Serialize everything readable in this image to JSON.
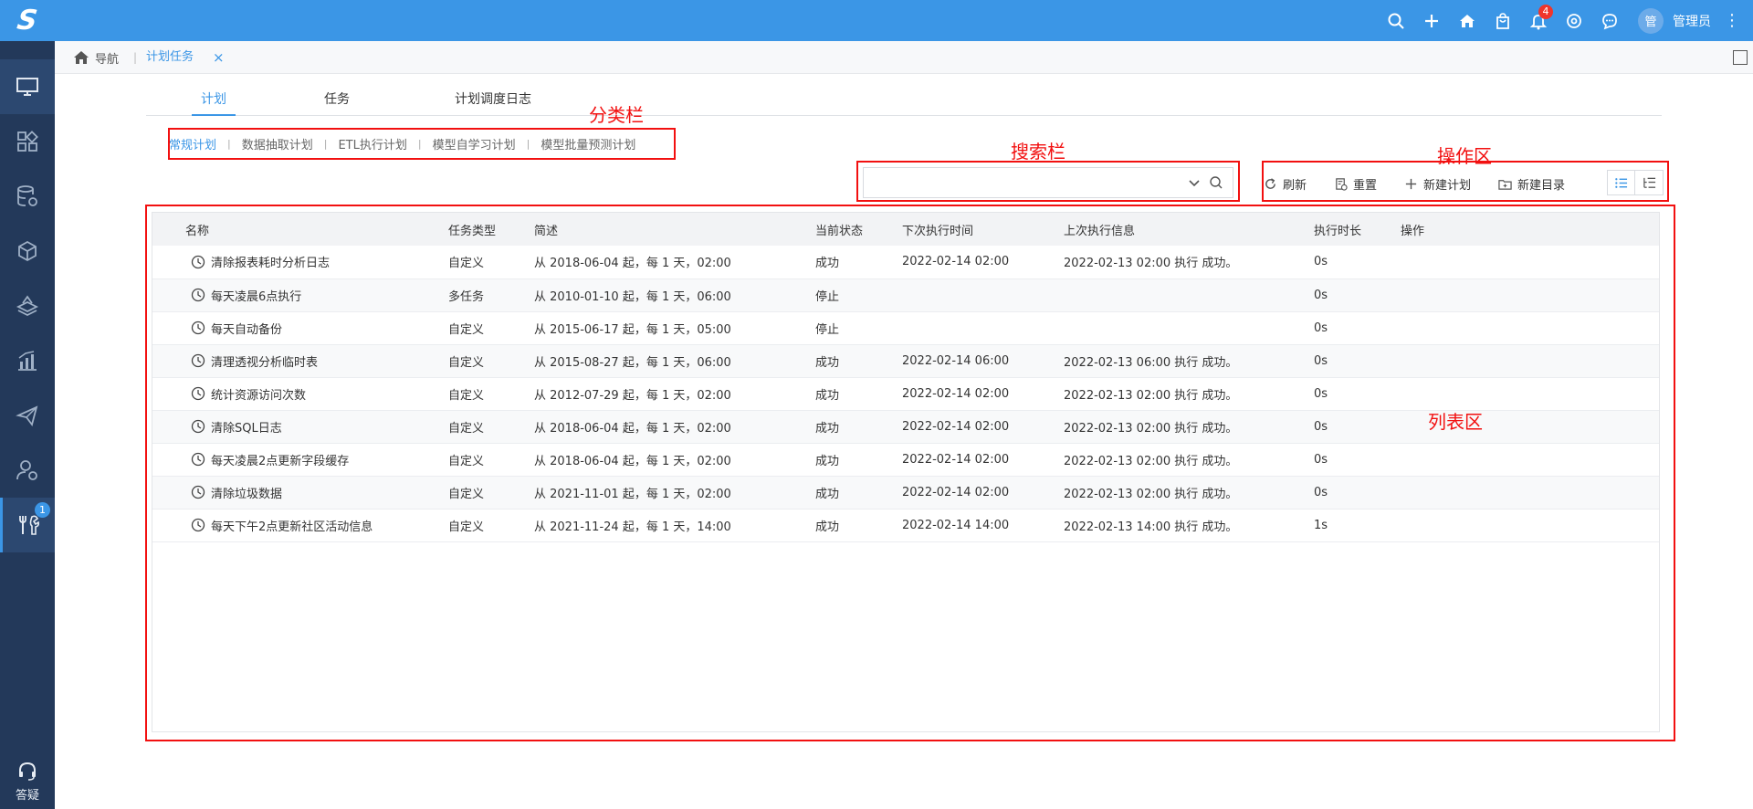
{
  "app": {
    "logo_letter": "S"
  },
  "topbar": {
    "notification_count": "4",
    "avatar_text": "管",
    "username": "管理员"
  },
  "sidebar": {
    "items": [
      {
        "icon": "monitor-icon",
        "active": true
      },
      {
        "icon": "grid-icon"
      },
      {
        "icon": "database-gear-icon"
      },
      {
        "icon": "cube-icon"
      },
      {
        "icon": "layers-icon"
      },
      {
        "icon": "bar-chart-icon"
      },
      {
        "icon": "send-icon"
      },
      {
        "icon": "user-gear-icon"
      },
      {
        "icon": "tools-icon",
        "badge": "1",
        "selected": true
      }
    ],
    "help_label": "答疑"
  },
  "breadcrumb": {
    "home_label": "导航",
    "separator": "|",
    "tab_label": "计划任务",
    "close_glyph": "×"
  },
  "tabs": [
    {
      "label": "计划",
      "active": true
    },
    {
      "label": "任务"
    },
    {
      "label": "计划调度日志"
    }
  ],
  "categories": {
    "items": [
      "常规计划",
      "数据抽取计划",
      "ETL执行计划",
      "模型自学习计划",
      "模型批量预测计划"
    ],
    "active_index": 0,
    "separator": "|"
  },
  "annotations": {
    "category_bar": "分类栏",
    "search_bar": "搜索栏",
    "action_area": "操作区",
    "list_area": "列表区"
  },
  "search": {
    "value": "",
    "placeholder": ""
  },
  "actions": {
    "refresh": "刷新",
    "reset": "重置",
    "new_plan": "新建计划",
    "new_folder": "新建目录"
  },
  "table": {
    "columns": [
      "名称",
      "任务类型",
      "简述",
      "当前状态",
      "下次执行时间",
      "上次执行信息",
      "执行时长",
      "操作"
    ],
    "rows": [
      {
        "name": "清除报表耗时分析日志",
        "type": "自定义",
        "desc": "从 2018-06-04 起，每 1 天，02:00",
        "status": "成功",
        "next": "2022-02-14 02:00",
        "last": "2022-02-13 02:00 执行 成功。",
        "duration": "0s"
      },
      {
        "name": "每天凌晨6点执行",
        "type": "多任务",
        "desc": "从 2010-01-10 起，每 1 天，06:00",
        "status": "停止",
        "next": "",
        "last": "",
        "duration": "0s"
      },
      {
        "name": "每天自动备份",
        "type": "自定义",
        "desc": "从 2015-06-17 起，每 1 天，05:00",
        "status": "停止",
        "next": "",
        "last": "",
        "duration": "0s"
      },
      {
        "name": "清理透视分析临时表",
        "type": "自定义",
        "desc": "从 2015-08-27 起，每 1 天，06:00",
        "status": "成功",
        "next": "2022-02-14 06:00",
        "last": "2022-02-13 06:00 执行 成功。",
        "duration": "0s"
      },
      {
        "name": "统计资源访问次数",
        "type": "自定义",
        "desc": "从 2012-07-29 起，每 1 天，02:00",
        "status": "成功",
        "next": "2022-02-14 02:00",
        "last": "2022-02-13 02:00 执行 成功。",
        "duration": "0s"
      },
      {
        "name": "清除SQL日志",
        "type": "自定义",
        "desc": "从 2018-06-04 起，每 1 天，02:00",
        "status": "成功",
        "next": "2022-02-14 02:00",
        "last": "2022-02-13 02:00 执行 成功。",
        "duration": "0s"
      },
      {
        "name": "每天凌晨2点更新字段缓存",
        "type": "自定义",
        "desc": "从 2018-06-04 起，每 1 天，02:00",
        "status": "成功",
        "next": "2022-02-14 02:00",
        "last": "2022-02-13 02:00 执行 成功。",
        "duration": "0s"
      },
      {
        "name": "清除垃圾数据",
        "type": "自定义",
        "desc": "从 2021-11-01 起，每 1 天，02:00",
        "status": "成功",
        "next": "2022-02-14 02:00",
        "last": "2022-02-13 02:00 执行 成功。",
        "duration": "0s"
      },
      {
        "name": "每天下午2点更新社区活动信息",
        "type": "自定义",
        "desc": "从 2021-11-24 起，每 1 天，14:00",
        "status": "成功",
        "next": "2022-02-14 14:00",
        "last": "2022-02-13 14:00 执行 成功。",
        "duration": "1s"
      }
    ]
  },
  "colors": {
    "accent": "#3b96e6",
    "sidebar": "#23395a",
    "annotation": "#f21010"
  }
}
